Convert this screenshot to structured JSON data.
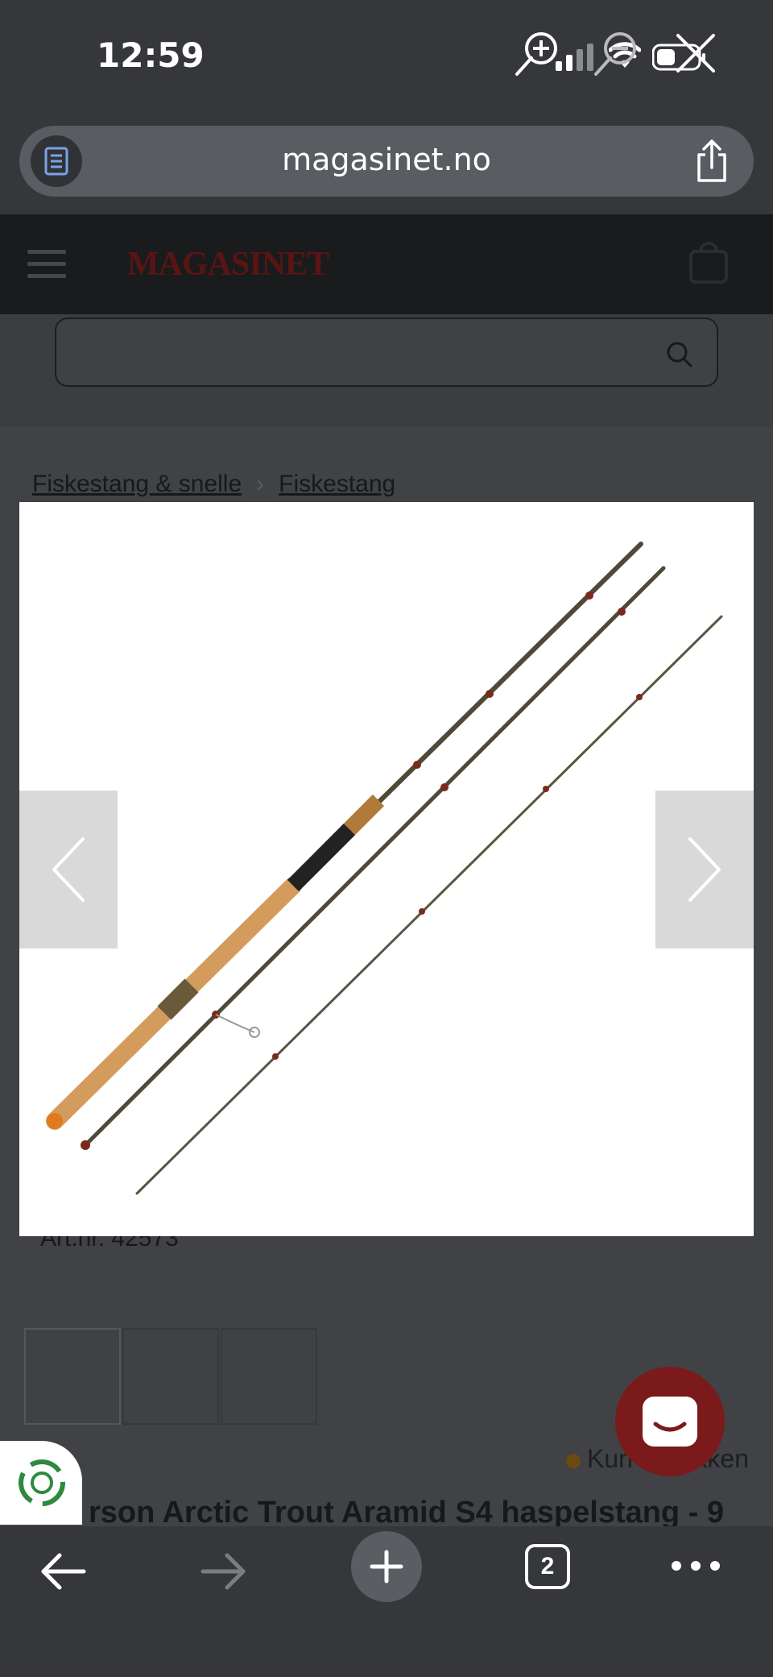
{
  "status_bar": {
    "time": "12:59"
  },
  "url_bar": {
    "url": "magasinet.no"
  },
  "site": {
    "brand": "MAGASINET",
    "search_placeholder": "",
    "breadcrumb": [
      "Fiskestang & snelle",
      "Fiskestang"
    ],
    "art_nr": "Art.nr. 42573",
    "stock_label": "Kun i butikken",
    "product_title": "rson Arctic Trout Aramid S4 haspelstang - 9"
  },
  "toolbar": {
    "tab_count": "2"
  },
  "colors": {
    "accent": "#7a1a1a",
    "toolbar": "#35373b"
  }
}
